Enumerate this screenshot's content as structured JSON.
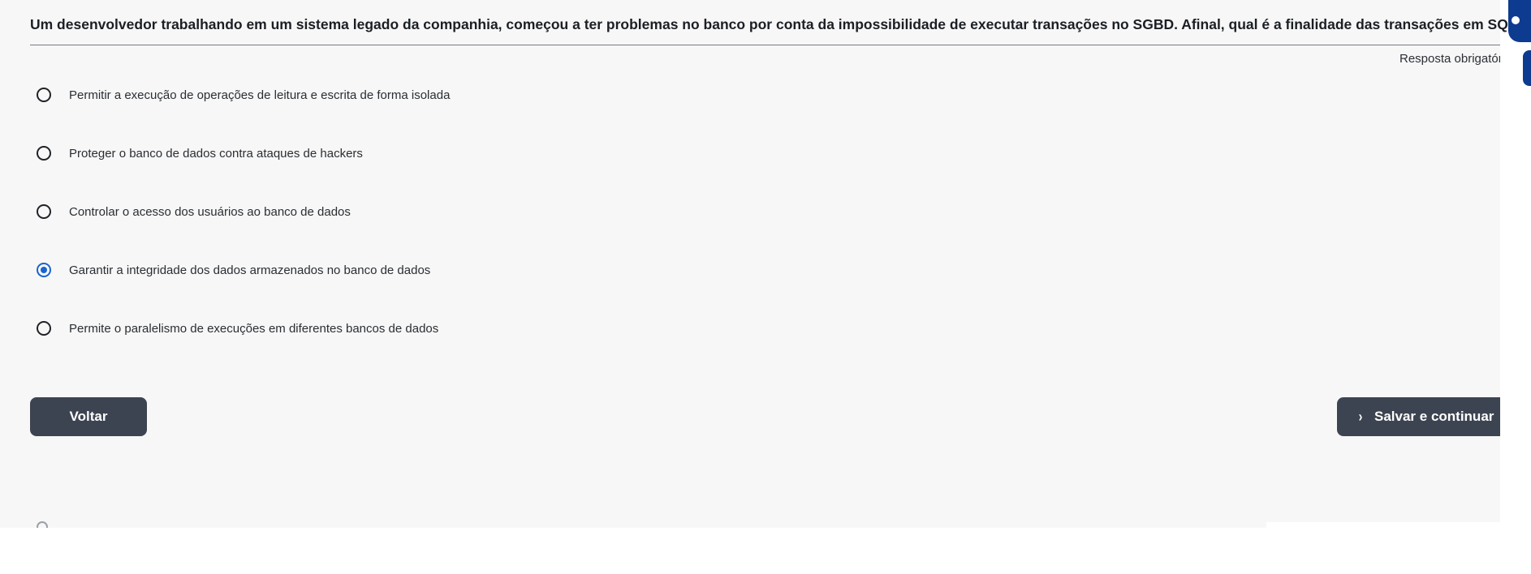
{
  "question": {
    "text": "Um desenvolvedor trabalhando em um sistema legado da companhia, começou a ter problemas no banco por conta da impossibilidade de executar transações no SGBD. Afinal, qual é a finalidade das transações em SQL?",
    "required_label": "Resposta obrigatór"
  },
  "options": [
    {
      "label": "Permitir a execução de operações de leitura e escrita de forma isolada",
      "selected": false
    },
    {
      "label": "Proteger o banco de dados contra ataques de hackers",
      "selected": false
    },
    {
      "label": "Controlar o acesso dos usuários ao banco de dados",
      "selected": false
    },
    {
      "label": "Garantir a integridade dos dados armazenados no banco de dados",
      "selected": true
    },
    {
      "label": "Permite o paralelismo de execuções em diferentes bancos de dados",
      "selected": false
    }
  ],
  "buttons": {
    "back_label": "Voltar",
    "next_label": "Salvar e continuar",
    "next_icon": "chevron-right-icon"
  },
  "colors": {
    "button_bg": "#3d4451",
    "radio_selected": "#1a64d1",
    "side_tab": "#0d3b8f"
  }
}
